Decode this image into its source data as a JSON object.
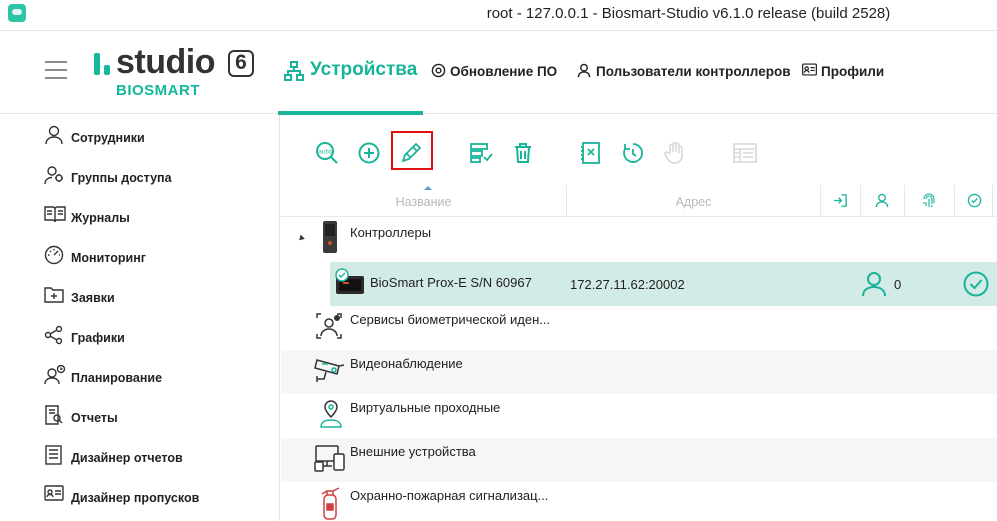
{
  "window": {
    "title": "root - 127.0.0.1 - Biosmart-Studio v6.1.0 release (build 2528)"
  },
  "logo": {
    "word": "studio",
    "number": "6",
    "subtitle": "BIOSMART"
  },
  "nav": {
    "devices": "Устройства",
    "update": "Обновление ПО",
    "users": "Пользователи контроллеров",
    "profiles": "Профили"
  },
  "sidebar": {
    "items": [
      {
        "label": "Сотрудники",
        "icon": "person-icon"
      },
      {
        "label": "Группы доступа",
        "icon": "group-icon"
      },
      {
        "label": "Журналы",
        "icon": "book-icon"
      },
      {
        "label": "Мониторинг",
        "icon": "gauge-icon"
      },
      {
        "label": "Заявки",
        "icon": "folder-plus-icon"
      },
      {
        "label": "Графики",
        "icon": "share-icon"
      },
      {
        "label": "Планирование",
        "icon": "person-clock-icon"
      },
      {
        "label": "Отчеты",
        "icon": "report-icon"
      },
      {
        "label": "Дизайнер отчетов",
        "icon": "report-designer-icon"
      },
      {
        "label": "Дизайнер пропусков",
        "icon": "badge-icon"
      }
    ]
  },
  "toolbar": {
    "auto_label": "auto"
  },
  "table": {
    "col_name": "Название",
    "col_address": "Адрес"
  },
  "tree": {
    "controllers": "Контроллеры",
    "device": {
      "name": "BioSmart Prox-E S/N 60967",
      "address": "172.27.11.62:20002",
      "users_count": "0"
    },
    "biometric": "Сервисы биометрической иден...",
    "video": "Видеонаблюдение",
    "virtual": "Виртуальные проходные",
    "external": "Внешние устройства",
    "fire": "Охранно-пожарная сигнализац..."
  },
  "colors": {
    "accent": "#19b49a",
    "selected_row": "#d3ebe6",
    "highlight": "#e01010"
  }
}
